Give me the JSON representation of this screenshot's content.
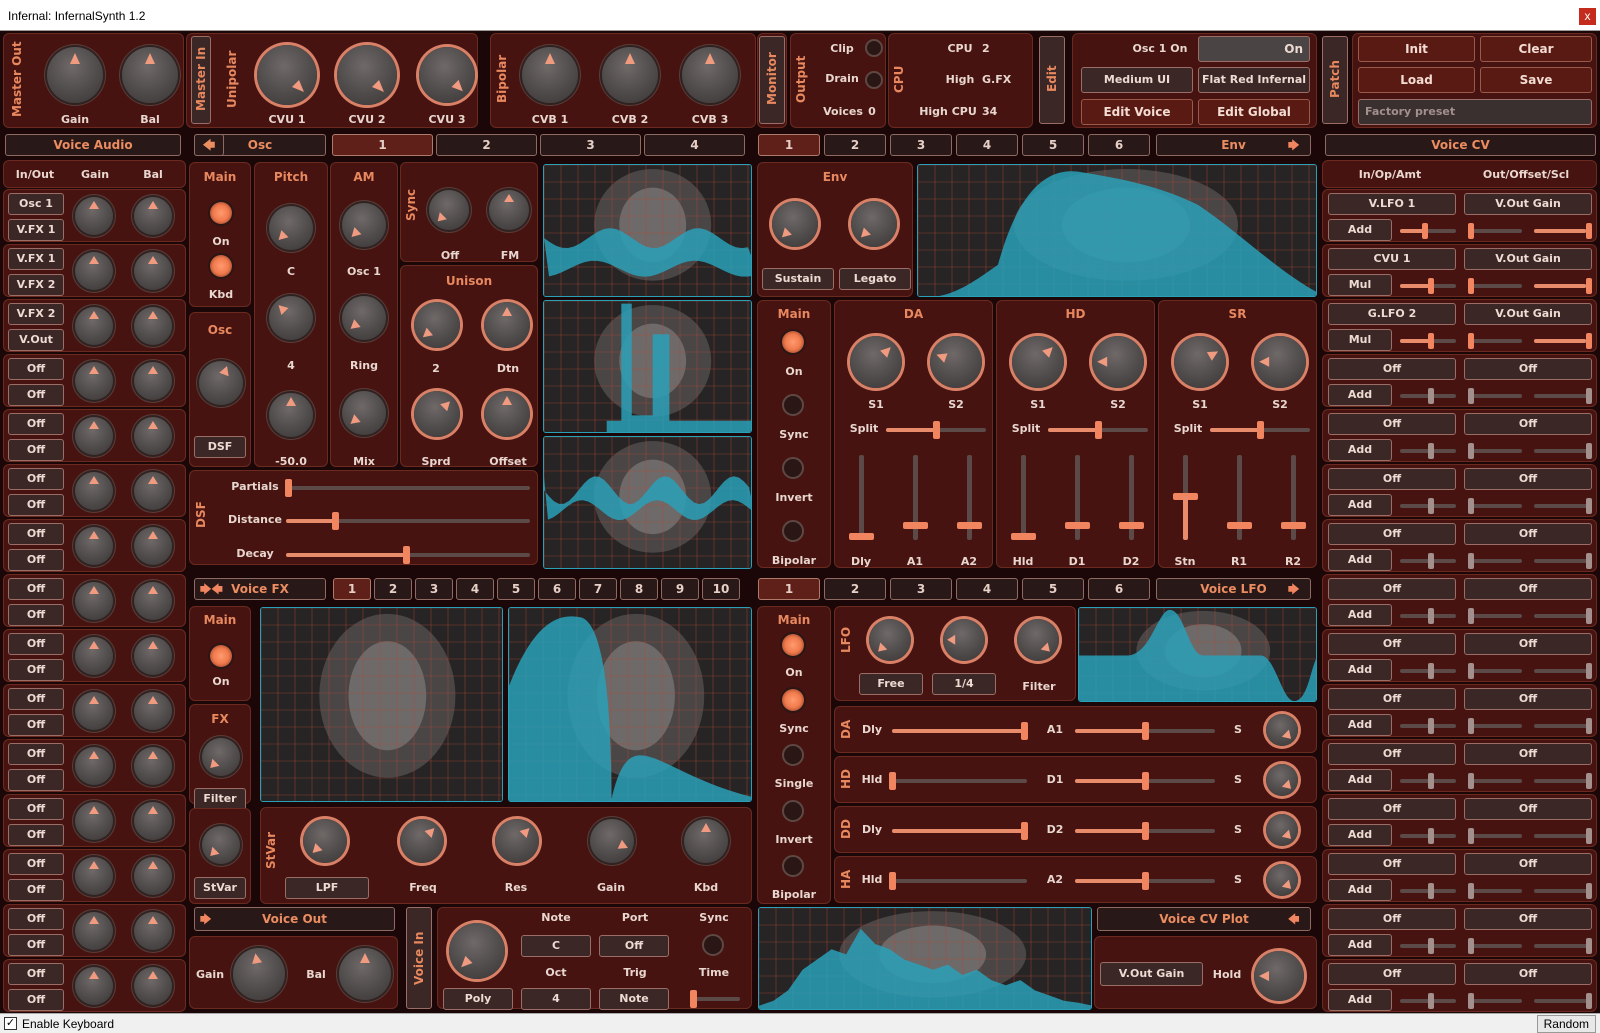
{
  "window": {
    "title": "Infernal: InfernalSynth 1.2",
    "close": "x"
  },
  "status": {
    "enable_keyboard": "Enable Keyboard",
    "random": "Random",
    "check": "✓"
  },
  "master_out": {
    "title": "Master Out",
    "gain": "Gain",
    "bal": "Bal"
  },
  "master_in": {
    "title": "Master In"
  },
  "unipolar": {
    "title": "Unipolar",
    "k1": "CVU 1",
    "k2": "CVU 2",
    "k3": "CVU 3"
  },
  "bipolar": {
    "title": "Bipolar",
    "k1": "CVB 1",
    "k2": "CVB 2",
    "k3": "CVB 3"
  },
  "monitor": {
    "title": "Monitor"
  },
  "output": {
    "title": "Output",
    "clip": "Clip",
    "drain": "Drain",
    "voices": "Voices",
    "voices_val": "0"
  },
  "cpu": {
    "title": "CPU",
    "cpu_l": "CPU",
    "cpu_v": "2",
    "high_l": "High",
    "high_v": "G.FX",
    "hcpu_l": "High CPU",
    "hcpu_v": "34"
  },
  "edit": {
    "title": "Edit",
    "osc1on": "Osc 1 On",
    "on": "On",
    "medium_ui": "Medium UI",
    "theme": "Flat Red Infernal",
    "edit_voice": "Edit Voice",
    "edit_global": "Edit Global"
  },
  "patch": {
    "title": "Patch",
    "init": "Init",
    "clear": "Clear",
    "load": "Load",
    "save": "Save",
    "preset": "Factory preset"
  },
  "voice_audio": {
    "header": "Voice Audio",
    "col1": "In/Out",
    "col2": "Gain",
    "col3": "Bal",
    "rows": [
      "Osc 1",
      "V.FX 1",
      "V.FX 1",
      "V.FX 2",
      "V.FX 2",
      "V.Out",
      "Off",
      "Off",
      "Off",
      "Off",
      "Off",
      "Off",
      "Off",
      "Off",
      "Off",
      "Off",
      "Off",
      "Off",
      "Off",
      "Off",
      "Off",
      "Off",
      "Off",
      "Off",
      "Off",
      "Off",
      "Off",
      "Off",
      "Off",
      "Off"
    ]
  },
  "osc": {
    "header": "Osc",
    "tabs": [
      "1",
      "2",
      "3",
      "4"
    ],
    "main": "Main",
    "on": "On",
    "kbd": "Kbd",
    "osc": "Osc",
    "dsf": "DSF",
    "pitch": "Pitch",
    "pitch_c": "C",
    "pitch_4": "4",
    "pitch_v": "-50.0",
    "am": "AM",
    "am_osc": "Osc 1",
    "am_ring": "Ring",
    "am_mix": "Mix",
    "sync": "Sync",
    "sync_off": "Off",
    "sync_fm": "FM",
    "unison": "Unison",
    "uni_2": "2",
    "uni_dtn": "Dtn",
    "uni_sprd": "Sprd",
    "uni_off": "Offset",
    "dsf_title": "DSF",
    "partials": "Partials",
    "distance": "Distance",
    "decay": "Decay"
  },
  "env": {
    "tabs": [
      "1",
      "2",
      "3",
      "4",
      "5",
      "6"
    ],
    "header": "Env",
    "env_title": "Env",
    "sustain": "Sustain",
    "legato": "Legato",
    "main": "Main",
    "on": "On",
    "sync": "Sync",
    "invert": "Invert",
    "bipolar": "Bipolar",
    "da": "DA",
    "hd": "HD",
    "sr": "SR",
    "s1": "S1",
    "s2": "S2",
    "split": "Split",
    "dly": "Dly",
    "a1": "A1",
    "a2": "A2",
    "hld": "Hld",
    "d1": "D1",
    "d2": "D2",
    "stn": "Stn",
    "r1": "R1",
    "r2": "R2"
  },
  "voice_fx": {
    "header": "Voice FX",
    "tabs": [
      "1",
      "2",
      "3",
      "4",
      "5",
      "6",
      "7",
      "8",
      "9",
      "10"
    ],
    "main": "Main",
    "on": "On",
    "fx": "FX",
    "filter": "Filter",
    "stvar": "StVar",
    "stvar_title": "StVar",
    "lpf": "LPF",
    "freq": "Freq",
    "res": "Res",
    "gain": "Gain",
    "kbd": "Kbd"
  },
  "voice_lfo": {
    "tabs": [
      "1",
      "2",
      "3",
      "4",
      "5",
      "6"
    ],
    "header": "Voice LFO",
    "main": "Main",
    "on": "On",
    "sync": "Sync",
    "single": "Single",
    "invert": "Invert",
    "bipolar": "Bipolar",
    "lfo": "LFO",
    "free": "Free",
    "quarter": "1/4",
    "filter": "Filter",
    "rows": [
      {
        "t": "DA",
        "a": "Dly",
        "b": "A1",
        "c": "S"
      },
      {
        "t": "HD",
        "a": "Hld",
        "b": "D1",
        "c": "S"
      },
      {
        "t": "DD",
        "a": "Dly",
        "b": "D2",
        "c": "S"
      },
      {
        "t": "HA",
        "a": "Hld",
        "b": "A2",
        "c": "S"
      }
    ]
  },
  "voice_out": {
    "header": "Voice Out",
    "gain": "Gain",
    "bal": "Bal"
  },
  "voice_in": {
    "title": "Voice In",
    "note": "Note",
    "port": "Port",
    "sync": "Sync",
    "note_v": "C",
    "port_v": "Off",
    "oct": "Oct",
    "trig": "Trig",
    "time": "Time",
    "poly": "Poly",
    "oct_v": "4",
    "trig_v": "Note"
  },
  "cv_plot": {
    "header": "Voice CV Plot",
    "vout": "V.Out Gain",
    "hold": "Hold"
  },
  "voice_cv": {
    "header": "Voice CV",
    "col1": "In/Op/Amt",
    "col2": "Out/Offset/Scl",
    "rows": [
      {
        "in": "V.LFO 1",
        "op": "Add",
        "out": "V.Out Gain"
      },
      {
        "in": "CVU 1",
        "op": "Mul",
        "out": "V.Out Gain"
      },
      {
        "in": "G.LFO 2",
        "op": "Mul",
        "out": "V.Out Gain"
      },
      {
        "in": "Off",
        "op": "Add",
        "out": "Off"
      },
      {
        "in": "Off",
        "op": "Add",
        "out": "Off"
      },
      {
        "in": "Off",
        "op": "Add",
        "out": "Off"
      },
      {
        "in": "Off",
        "op": "Add",
        "out": "Off"
      },
      {
        "in": "Off",
        "op": "Add",
        "out": "Off"
      },
      {
        "in": "Off",
        "op": "Add",
        "out": "Off"
      },
      {
        "in": "Off",
        "op": "Add",
        "out": "Off"
      },
      {
        "in": "Off",
        "op": "Add",
        "out": "Off"
      },
      {
        "in": "Off",
        "op": "Add",
        "out": "Off"
      },
      {
        "in": "Off",
        "op": "Add",
        "out": "Off"
      },
      {
        "in": "Off",
        "op": "Add",
        "out": "Off"
      },
      {
        "in": "Off",
        "op": "Add",
        "out": "Off"
      }
    ]
  },
  "colors": {
    "bg": "#1b0707",
    "panel": "#461311",
    "accent": "#e8885f",
    "plot": "#2aa0b8"
  }
}
